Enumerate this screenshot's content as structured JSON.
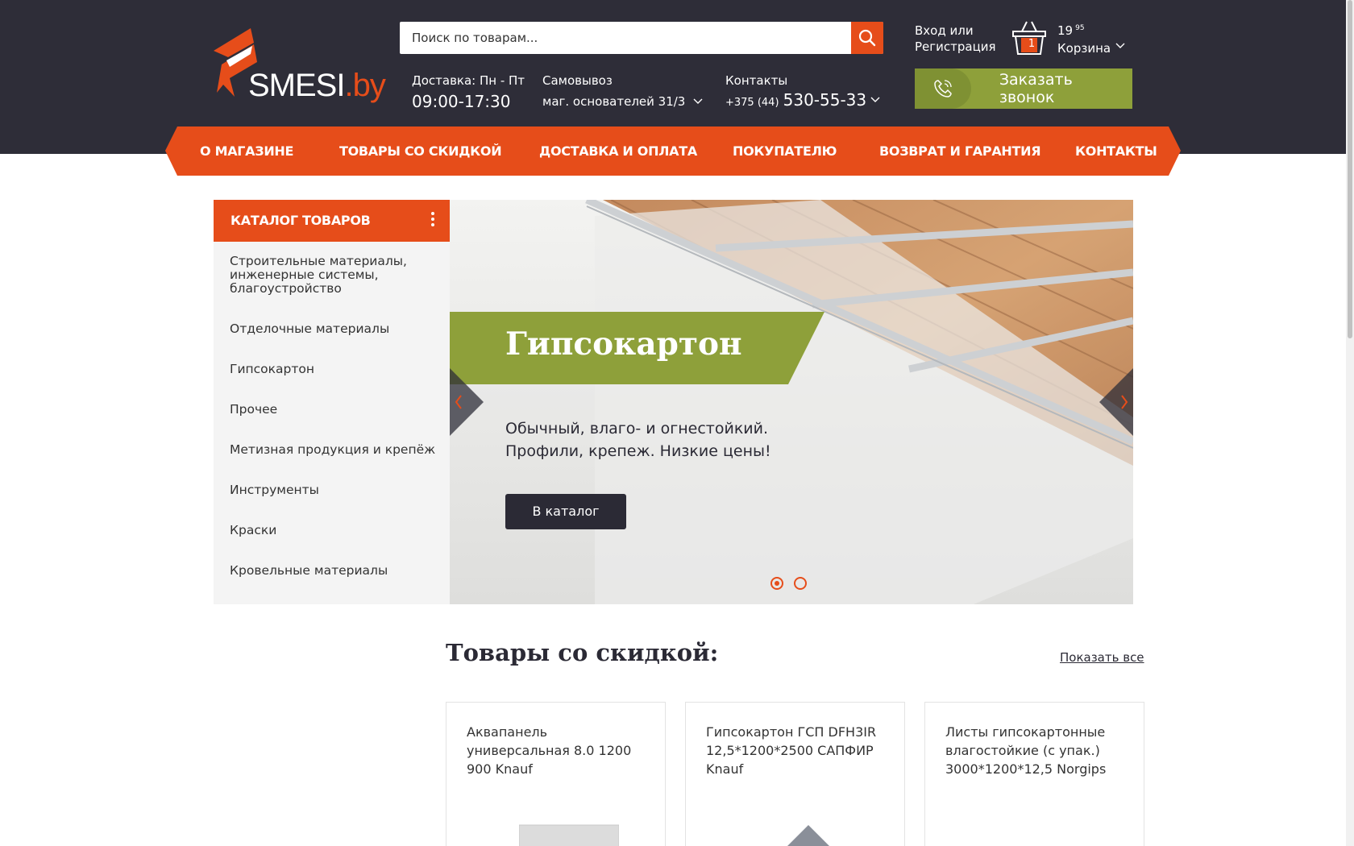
{
  "brand": {
    "logo_text_main": "SMESI",
    "logo_text_suffix": ".by",
    "accent_color": "#e64d1a",
    "header_bg": "#2e2d38",
    "green": "#8ea03a"
  },
  "search": {
    "placeholder": "Поиск по товарам..."
  },
  "account": {
    "login": "Вход или",
    "register": "Регистрация"
  },
  "cart": {
    "count": "1",
    "sum_main": "19",
    "sum_fraction": "95",
    "label": "Корзина"
  },
  "delivery": {
    "label": "Доставка: Пн - Пт",
    "hours": "09:00-17:30"
  },
  "pickup": {
    "label": "Самовывоз",
    "address": "маг. основателей 31/3"
  },
  "contacts": {
    "label": "Контакты",
    "prefix": "+375 (44)",
    "phone": "530-55-33"
  },
  "callback": {
    "label": "Заказать звонок"
  },
  "nav": {
    "items": [
      {
        "label": "О МАГАЗИНЕ"
      },
      {
        "label": "ТОВАРЫ СО СКИДКОЙ"
      },
      {
        "label": "ДОСТАВКА И ОПЛАТА"
      },
      {
        "label": "ПОКУПАТЕЛЮ"
      },
      {
        "label": "ВОЗВРАТ И ГАРАНТИЯ"
      },
      {
        "label": "КОНТАКТЫ"
      }
    ]
  },
  "catalog": {
    "title": "КАТАЛОГ ТОВАРОВ",
    "items": [
      {
        "label": "Строительные материалы, инженерные системы, благоустройство"
      },
      {
        "label": "Отделочные материалы"
      },
      {
        "label": "Гипсокартон"
      },
      {
        "label": "Прочее"
      },
      {
        "label": "Метизная продукция и крепёж"
      },
      {
        "label": "Инструменты"
      },
      {
        "label": "Краски"
      },
      {
        "label": "Кровельные материалы"
      }
    ]
  },
  "slider": {
    "title": "Гипсокартон",
    "desc_line1": "Обычный, влаго- и огнестойкий.",
    "desc_line2": "Профили, крепеж. Низкие цены!",
    "button": "В каталог",
    "slides_total": 2,
    "active_slide": 1
  },
  "discounts": {
    "title": "Товары со скидкой:",
    "show_all": "Показать все",
    "products": [
      {
        "title": "Аквапанель универсальная 8.0 1200 900 Knauf"
      },
      {
        "title": "Гипсокартон ГСП DFH3IR 12,5*1200*2500 САПФИР Knauf"
      },
      {
        "title": "Листы гипсокартонные влагостойкие (с упак.) 3000*1200*12,5 Norgips"
      }
    ]
  }
}
